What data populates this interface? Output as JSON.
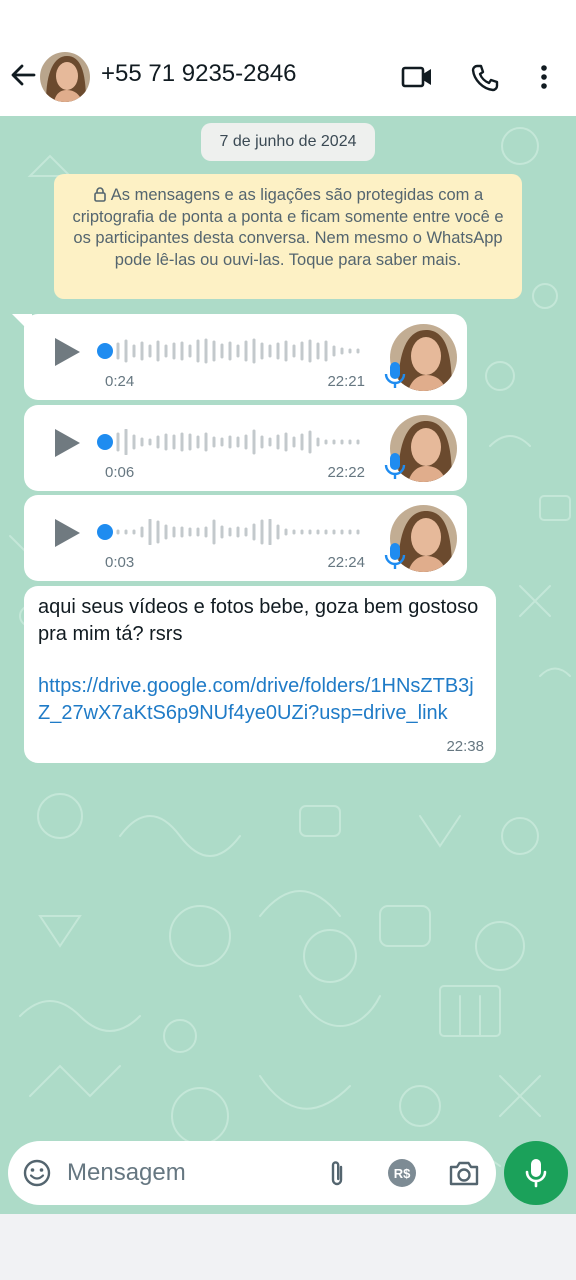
{
  "header": {
    "title": "+55 71 9235-2846",
    "back_icon": "arrow-back-icon",
    "video_icon": "video-call-icon",
    "call_icon": "phone-call-icon",
    "menu_icon": "more-vert-icon"
  },
  "chat": {
    "date": "7 de junho de 2024",
    "encryption_notice": "As mensagens e as ligações são protegidas com a criptografia de ponta a ponta e ficam somente entre você e os participantes desta conversa. Nem mesmo o WhatsApp pode lê-las ou ouvi-las. Toque para saber mais.",
    "voice_messages": [
      {
        "duration": "0:24",
        "time": "22:21"
      },
      {
        "duration": "0:06",
        "time": "22:22"
      },
      {
        "duration": "0:03",
        "time": "22:24"
      }
    ],
    "text_message": {
      "text": "aqui seus vídeos e fotos bebe, goza bem gostoso pra mim tá? rsrs",
      "link": "https://drive.google.com/drive/folders/1HNsZTB3jZ_27wX7aKtS6p9NUf4ye0UZi?usp=drive_link",
      "time": "22:38"
    }
  },
  "composer": {
    "placeholder": "Mensagem",
    "emoji_icon": "emoji-icon",
    "attach_icon": "paperclip-icon",
    "payment_icon": "payment-icon",
    "payment_label": "R$",
    "camera_icon": "camera-icon",
    "mic_icon": "microphone-icon"
  },
  "colors": {
    "chat_background": "#addbc8",
    "accent_green": "#1ba15a",
    "link_blue": "#1f7bc7",
    "notice_yellow": "#fdf1c5",
    "progress_blue": "#1f8cf0"
  }
}
